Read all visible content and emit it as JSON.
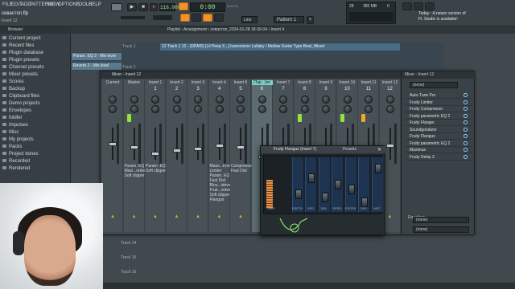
{
  "menu": {
    "items": [
      "FILE",
      "EDIT",
      "ADD",
      "PATTERNS",
      "VIEW",
      "OPTIONS",
      "TOOLS",
      "HELP"
    ]
  },
  "project": {
    "title": "севастоп.flp",
    "sub": "Insert 12"
  },
  "transport": {
    "tempo": "116.000",
    "time": "0:00",
    "time_unit": "M:S:CS",
    "pattern": "Pattern 1",
    "line_mode": "Line",
    "cpu": "28",
    "ram": "385 MB",
    "poly": "0"
  },
  "news": {
    "line1": "Today · A newer version of",
    "line2": "FL Studio is available!"
  },
  "browser": {
    "header": "Browser",
    "items": [
      "Current project",
      "Recent files",
      "Plugin database",
      "Plugin presets",
      "Channel presets",
      "Mixer presets",
      "Scores",
      "Backup",
      "Clipboard files",
      "Demo projects",
      "Envelopes",
      "foldfel",
      "Impulses",
      "Misc",
      "My projects",
      "Packs",
      "Project bones",
      "Recorded",
      "Rendered"
    ]
  },
  "playlist": {
    "header": "Playlist - Arrangement › севастоп_2024-01-28 18-39-04 › Insert 4",
    "clips": [
      "Param. EQ 2 - Mix level",
      "Reverb 2 - Mix level",
      "12 Track 1 12 - (DRMS) [Lil Peep X...] harmonizer Lullaby / Mellow Guitar Type Beat_Mixed"
    ],
    "tracks": [
      "Track 1",
      "Track 2",
      "Track 14",
      "Track 15",
      "Track 16"
    ]
  },
  "mixer": {
    "title": "Mixer - Insert 12",
    "strips": [
      {
        "name": "Current",
        "num": ""
      },
      {
        "name": "Master",
        "num": ""
      },
      {
        "name": "Insert 1",
        "num": "1"
      },
      {
        "name": "Insert 2",
        "num": "2"
      },
      {
        "name": "Insert 3",
        "num": "3"
      },
      {
        "name": "Insert 4",
        "num": "4"
      },
      {
        "name": "Insert 5",
        "num": "5"
      },
      {
        "name": "(Tap...)on",
        "num": "6"
      },
      {
        "name": "Insert 7",
        "num": "7"
      },
      {
        "name": "Insert 8",
        "num": "8"
      },
      {
        "name": "Insert 9",
        "num": "9"
      },
      {
        "name": "Insert 10",
        "num": "10"
      },
      {
        "name": "Insert 11",
        "num": "11"
      },
      {
        "name": "Insert 12",
        "num": "12"
      }
    ],
    "fx_master": "Param. EQ 2\nMaxi...order\nSoft clipper",
    "fx_insert1": "Param. EQ 2\nSoft clipper",
    "fx_insert4": "Maxe...tronic\nLimiter\nParam. EQ 2\nFast Dist\nBlou...idrive\nFruit...volver\nSoft clipper\nFlangus",
    "fx_insert5": "Compressor\nFast Dist"
  },
  "insert_panel": {
    "title": "Mixer - Insert 12",
    "preset": "(none)",
    "slots": [
      "Auto-Tune Pro",
      "Fruity Limiter",
      "Fruity Compressor",
      "Fruity parametric EQ 2",
      "Fruity Flanger",
      "Soundgoodizer",
      "Fruity Flangus",
      "Fruity parametric EQ 2",
      "Maximus",
      "Fruity Delay 3"
    ],
    "eq_label": "Equalizer",
    "out_in": "(none)",
    "out_out": "(none)"
  },
  "flangus": {
    "title": "Fruity Flangus (Insert 7)",
    "presets": "Presets",
    "labels": [
      "ORD",
      "DEPTH",
      "SPD",
      "DEL",
      "SPRD",
      "CROSS",
      "DRY",
      "WET"
    ]
  }
}
